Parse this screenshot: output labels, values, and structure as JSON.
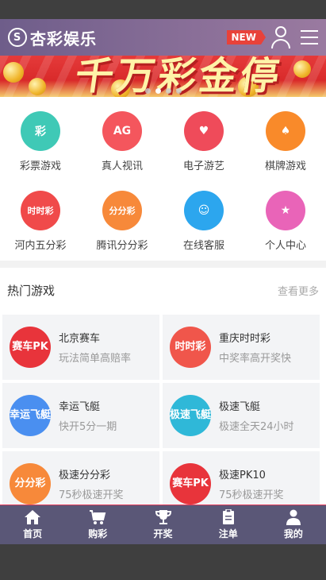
{
  "app": {
    "brand_name": "杏彩娱乐",
    "logo_glyph": "S",
    "new_badge": "NEW",
    "accent_colors": {
      "header": "#7a668f",
      "tabbar": "#5a5777",
      "tab_border": "#e33b5a"
    }
  },
  "banner": {
    "headline": "千万彩金停",
    "slides_total": 4,
    "active_slide": 2
  },
  "categories": [
    {
      "label": "彩票游戏",
      "icon": "lottery-icon",
      "glyph": "彩",
      "color": "#3fc9b6"
    },
    {
      "label": "真人视讯",
      "icon": "live-casino-icon",
      "glyph": "AG",
      "color": "#f4565d"
    },
    {
      "label": "电子游艺",
      "icon": "slots-icon",
      "glyph": "♥",
      "color": "#ef4b5a"
    },
    {
      "label": "棋牌游戏",
      "icon": "card-games-icon",
      "glyph": "♠",
      "color": "#f98a2a"
    },
    {
      "label": "河内五分彩",
      "icon": "hanoi-lottery-icon",
      "glyph": "时时彩",
      "color": "#f04a4a"
    },
    {
      "label": "腾讯分分彩",
      "icon": "tencent-lottery-icon",
      "glyph": "分分彩",
      "color": "#f7893a"
    },
    {
      "label": "在线客服",
      "icon": "customer-service-icon",
      "glyph": "☺",
      "color": "#2ca6ee"
    },
    {
      "label": "个人中心",
      "icon": "star-icon",
      "glyph": "★",
      "color": "#e964b8"
    }
  ],
  "hot": {
    "title": "热门游戏",
    "more": "查看更多",
    "games": [
      {
        "name": "北京赛车",
        "desc": "玩法简单高赔率",
        "glyph": "赛车PK",
        "color": "#e8343b"
      },
      {
        "name": "重庆时时彩",
        "desc": "中奖率高开奖快",
        "glyph": "时时彩",
        "color": "#f0564b"
      },
      {
        "name": "幸运飞艇",
        "desc": "快开5分一期",
        "glyph": "幸运飞艇",
        "color": "#4a8ff0"
      },
      {
        "name": "极速飞艇",
        "desc": "极速全天24小时",
        "glyph": "极速飞艇",
        "color": "#2fb8d8"
      },
      {
        "name": "极速分分彩",
        "desc": "75秒极速开奖",
        "glyph": "分分彩",
        "color": "#f7893a"
      },
      {
        "name": "极速PK10",
        "desc": "75秒极速开奖",
        "glyph": "赛车PK",
        "color": "#e8343b"
      }
    ]
  },
  "tabs": [
    {
      "label": "首页",
      "icon": "home-icon"
    },
    {
      "label": "购彩",
      "icon": "cart-icon"
    },
    {
      "label": "开奖",
      "icon": "trophy-icon"
    },
    {
      "label": "注单",
      "icon": "clipboard-icon"
    },
    {
      "label": "我的",
      "icon": "person-icon"
    }
  ]
}
